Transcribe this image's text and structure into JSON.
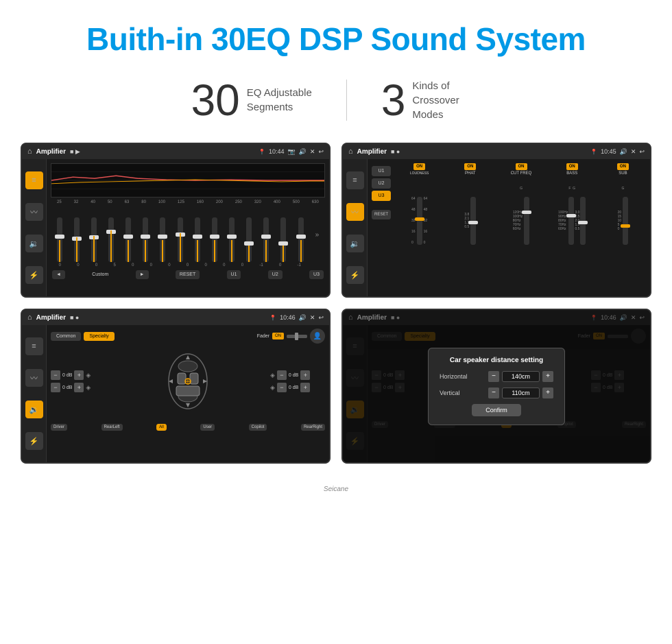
{
  "header": {
    "title": "Buith-in 30EQ DSP Sound System"
  },
  "stats": [
    {
      "number": "30",
      "label": "EQ Adjustable\nSegments"
    },
    {
      "number": "3",
      "label": "Kinds of\nCrossover Modes"
    }
  ],
  "screens": [
    {
      "id": "screen-eq",
      "status": {
        "title": "Amplifier",
        "time": "10:44"
      },
      "type": "eq"
    },
    {
      "id": "screen-crossover",
      "status": {
        "title": "Amplifier",
        "time": "10:45"
      },
      "type": "crossover"
    },
    {
      "id": "screen-specialty",
      "status": {
        "title": "Amplifier",
        "time": "10:46"
      },
      "type": "specialty"
    },
    {
      "id": "screen-dialog",
      "status": {
        "title": "Amplifier",
        "time": "10:46"
      },
      "type": "dialog"
    }
  ],
  "eq": {
    "frequencies": [
      "25",
      "32",
      "40",
      "50",
      "63",
      "80",
      "100",
      "125",
      "160",
      "200",
      "250",
      "320",
      "400",
      "500",
      "630"
    ],
    "values": [
      "0",
      "0",
      "0",
      "5",
      "0",
      "0",
      "0",
      "0",
      "0",
      "0",
      "0",
      "-1",
      "0",
      "-1"
    ],
    "bottom_buttons": [
      "◄",
      "Custom",
      "►",
      "RESET",
      "U1",
      "U2",
      "U3"
    ]
  },
  "crossover": {
    "presets": [
      "U1",
      "U2",
      "U3"
    ],
    "active_preset": "U3",
    "channels": [
      {
        "name": "LOUDNESS",
        "on": true
      },
      {
        "name": "PHAT",
        "on": true
      },
      {
        "name": "CUT FREQ",
        "on": true
      },
      {
        "name": "BASS",
        "on": true
      },
      {
        "name": "SUB",
        "on": true
      }
    ]
  },
  "specialty": {
    "tabs": [
      "Common",
      "Specialty"
    ],
    "active_tab": "Specialty",
    "fader_label": "Fader",
    "fader_on": "ON",
    "speaker_positions": [
      {
        "label": "Driver",
        "db": "0 dB"
      },
      {
        "label": "Copilot",
        "db": "0 dB"
      },
      {
        "label": "RearLeft",
        "db": "0 dB"
      },
      {
        "label": "RearRight",
        "db": "0 dB"
      }
    ],
    "buttons": [
      "Driver",
      "RearLeft",
      "All",
      "User",
      "Copilot",
      "RearRight"
    ]
  },
  "dialog": {
    "title": "Car speaker distance setting",
    "horizontal_label": "Horizontal",
    "horizontal_value": "140cm",
    "vertical_label": "Vertical",
    "vertical_value": "110cm",
    "confirm_label": "Confirm"
  },
  "watermark": "Seicane"
}
